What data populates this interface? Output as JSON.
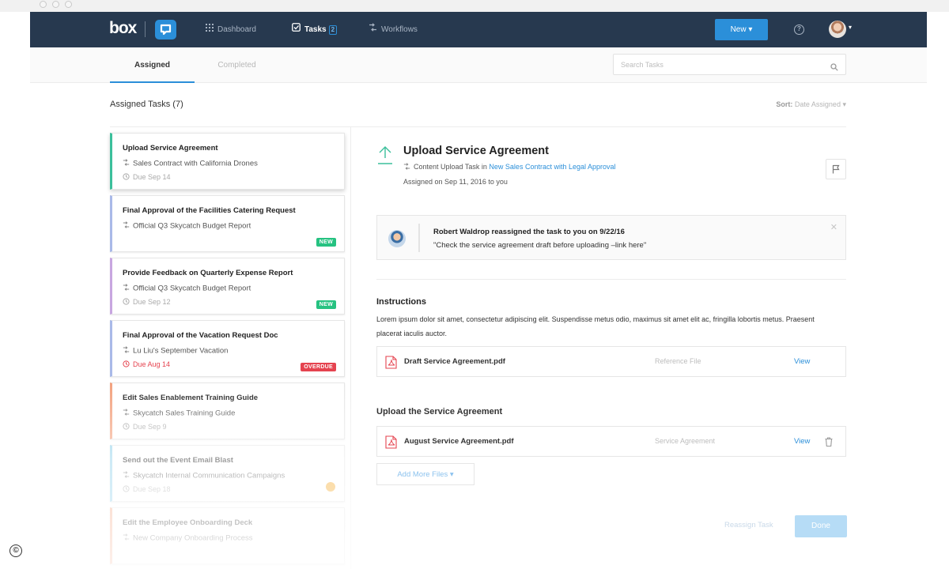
{
  "nav": {
    "logo": "box",
    "items": [
      {
        "label": "Dashboard",
        "icon": "grid-icon"
      },
      {
        "label": "Tasks",
        "icon": "checkbox-icon",
        "count": "2"
      },
      {
        "label": "Workflows",
        "icon": "workflow-icon"
      }
    ],
    "new_label": "New",
    "help_glyph": "?"
  },
  "tabs": {
    "assigned": "Assigned",
    "completed": "Completed"
  },
  "search": {
    "placeholder": "Search Tasks"
  },
  "list": {
    "title": "Assigned Tasks (7)",
    "sort_label": "Sort:",
    "sort_value": "Date Assigned",
    "cards": [
      {
        "title": "Upload Service Agreement",
        "subtitle": "Sales Contract with California Drones",
        "due": "Due Sep 14",
        "badge": "",
        "accent": "#3bbf9b"
      },
      {
        "title": "Final Approval of the Facilities Catering Request",
        "subtitle": "Official Q3 Skycatch Budget Report",
        "due": "",
        "badge": "NEW",
        "accent": "#a9b9e8"
      },
      {
        "title": "Provide Feedback on Quarterly Expense Report",
        "subtitle": "Official Q3 Skycatch Budget Report",
        "due": "Due Sep 12",
        "badge": "NEW",
        "accent": "#c8a6e0"
      },
      {
        "title": "Final Approval of the Vacation Request Doc",
        "subtitle": "Lu Liu's September Vacation",
        "due": "Due Aug 14",
        "badge": "OVERDUE",
        "accent": "#a9b9e8"
      },
      {
        "title": "Edit Sales Enablement Training Guide",
        "subtitle": "Skycatch Sales Training Guide",
        "due": "Due Sep 9",
        "badge": "",
        "accent": "#f3a27f"
      },
      {
        "title": "Send out the Event Email Blast",
        "subtitle": "Skycatch Internal Communication Campaigns",
        "due": "Due Sep 18",
        "badge": "",
        "accent": "#8fd0ea"
      },
      {
        "title": "Edit the Employee Onboarding Deck",
        "subtitle": "New Company Onboarding Process",
        "due": "",
        "badge": "",
        "accent": "#f3a27f"
      }
    ]
  },
  "detail": {
    "title": "Upload Service Agreement",
    "meta_prefix": "Content Upload Task in",
    "meta_link": "New Sales Contract with Legal Approval",
    "assigned": "Assigned on Sep 11, 2016 to you",
    "note": {
      "name": "Robert Waldrop reassigned the task to you on 9/22/16",
      "text": "\"Check the service agreement draft before uploading –link here\""
    },
    "instructions_title": "Instructions",
    "instructions_text": "Lorem ipsum dolor sit amet, consectetur adipiscing elit. Suspendisse metus odio, maximus sit amet elit ac, fringilla lobortis metus. Praesent placerat iaculis auctor.",
    "reference_file": {
      "name": "Draft Service Agreement.pdf",
      "type": "Reference File",
      "action": "View"
    },
    "upload_title": "Upload the Service Agreement",
    "uploaded_file": {
      "name": "August Service Agreement.pdf",
      "type": "Service Agreement",
      "action": "View"
    },
    "add_files": "Add More Files",
    "reassign": "Reassign Task",
    "done": "Done"
  },
  "colors": {
    "nav_bg": "#27394f",
    "accent": "#2b8fd9",
    "new_badge": "#26c281",
    "overdue": "#e5434f"
  },
  "copyright": "©"
}
